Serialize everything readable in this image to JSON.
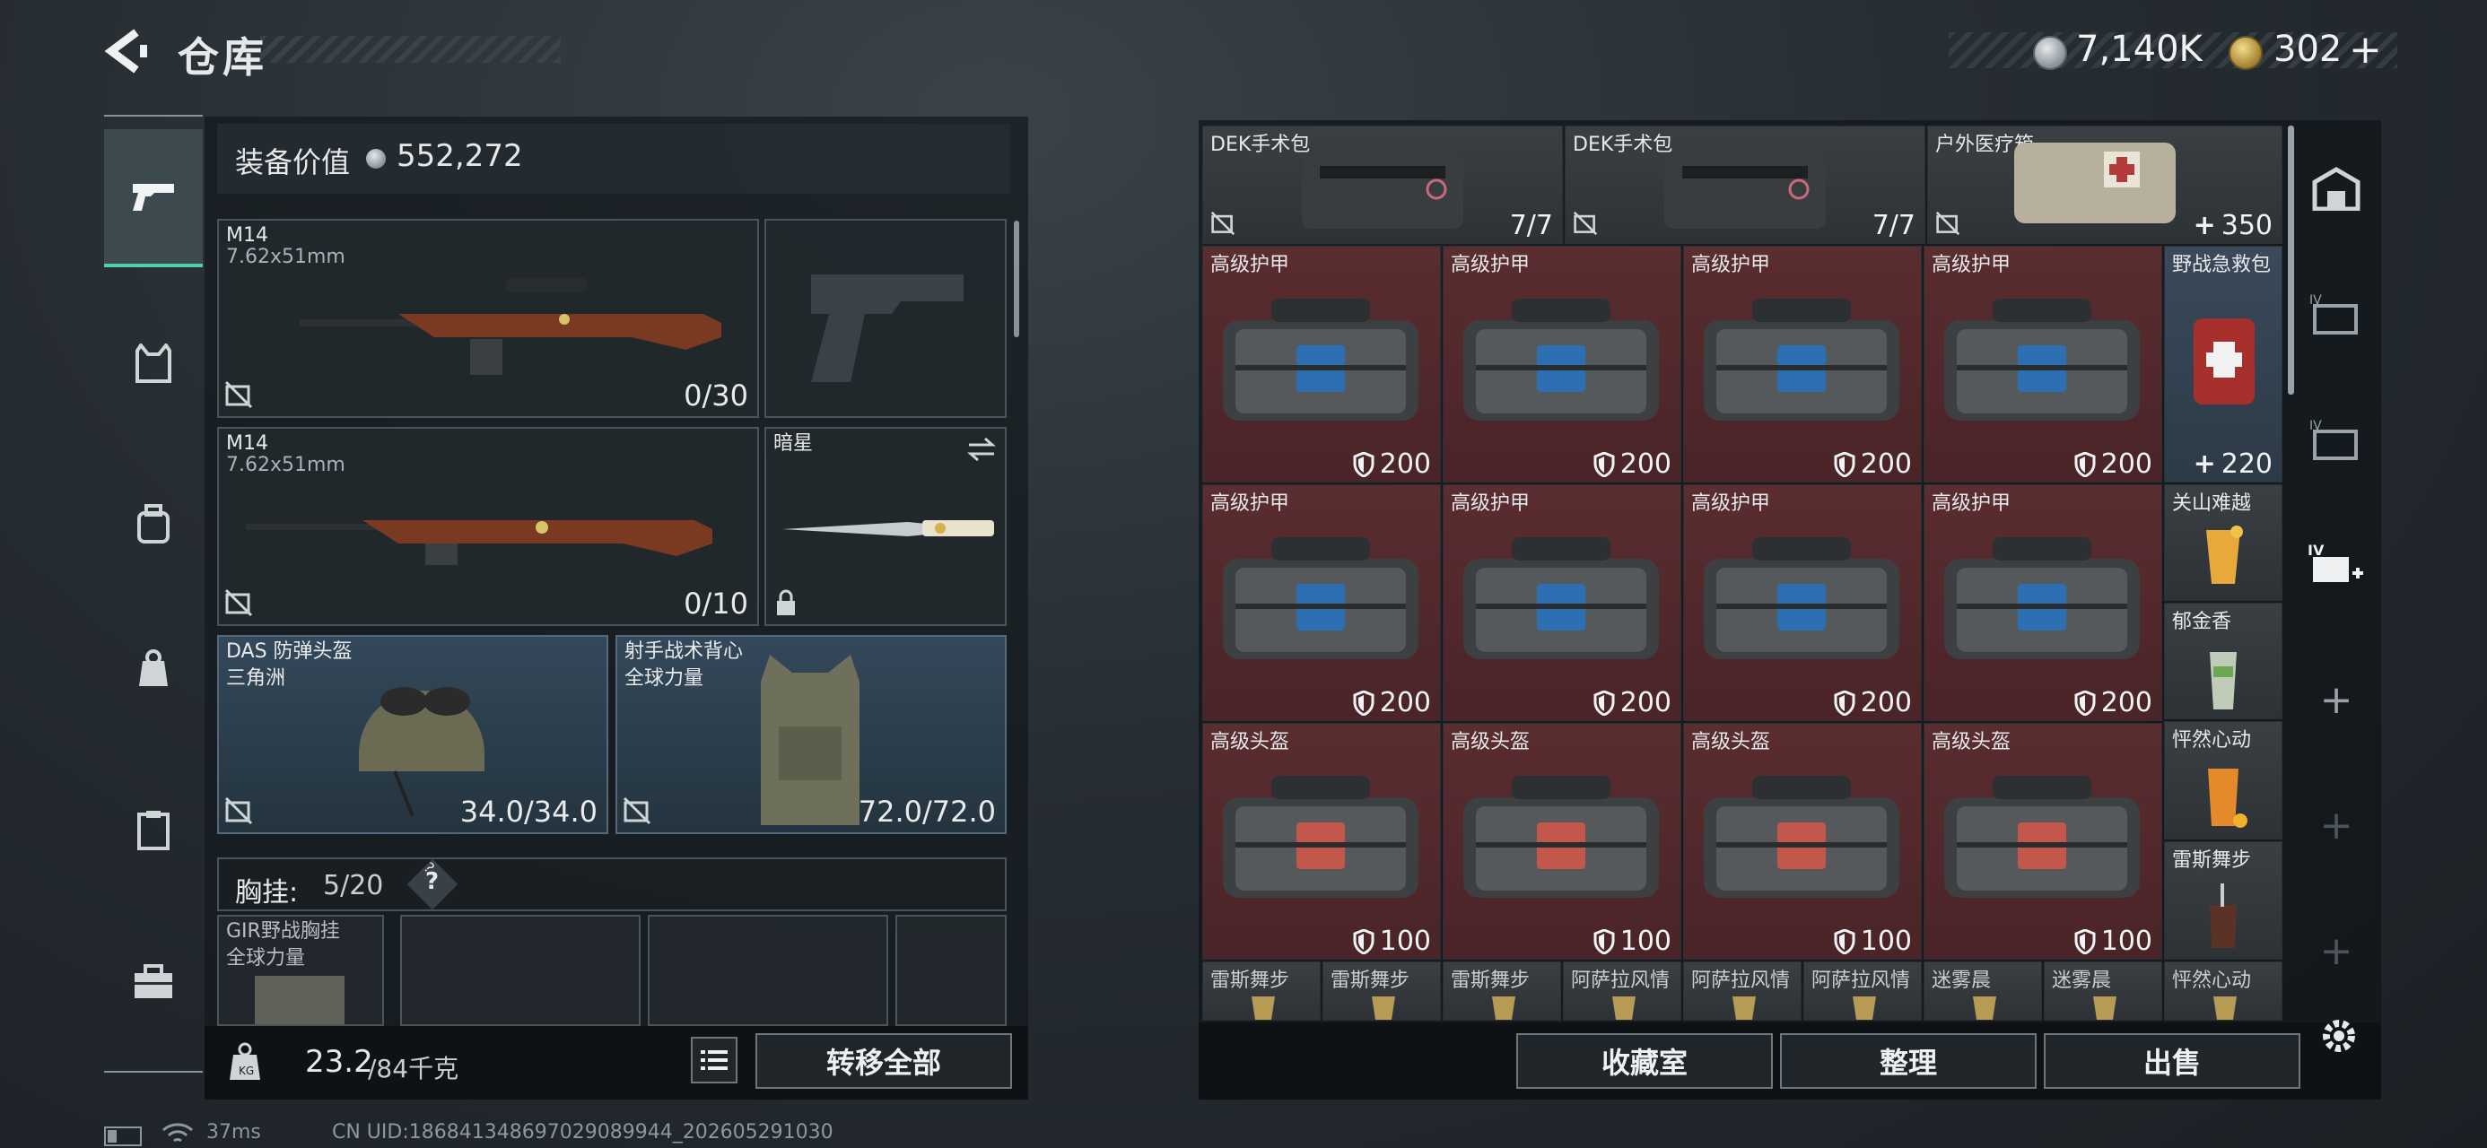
{
  "header": {
    "title": "仓库"
  },
  "currency": [
    {
      "icon": "silver-coin-icon",
      "value": "7,140K"
    },
    {
      "icon": "gold-coin-icon",
      "value": "302",
      "action": "+"
    }
  ],
  "equipment": {
    "value_label": "装备价值",
    "value": "552,272",
    "slots": [
      {
        "name": "M14",
        "sub": "7.62x51mm",
        "count": "0/30"
      },
      {
        "name": "M14",
        "sub": "7.62x51mm",
        "count": "0/10"
      },
      {
        "name": "暗星",
        "sub": "",
        "count": ""
      },
      {
        "name": "DAS 防弹头盔",
        "sub": "三角洲",
        "count": "34.0/34.0"
      },
      {
        "name": "射手战术背心",
        "sub": "全球力量",
        "count": "72.0/72.0"
      }
    ],
    "rig_label": "胸挂:",
    "rig_count": "5/20",
    "rig_help": "?",
    "rig_slots": [
      {
        "name": "GIR野战胸挂",
        "sub": "全球力量"
      }
    ]
  },
  "bottom": {
    "weight": "23.2",
    "weight_max": "/84千克",
    "transfer_all": "转移全部"
  },
  "stash": {
    "top_row": [
      {
        "name": "DEK手术包",
        "value": "7/7"
      },
      {
        "name": "DEK手术包",
        "value": "7/7"
      },
      {
        "name": "户外医疗箱",
        "value": "350"
      }
    ],
    "grid": [
      [
        {
          "name": "高级护甲",
          "value": "200"
        },
        {
          "name": "高级护甲",
          "value": "200"
        },
        {
          "name": "高级护甲",
          "value": "200"
        },
        {
          "name": "高级护甲",
          "value": "200"
        }
      ],
      [
        {
          "name": "高级护甲",
          "value": "200"
        },
        {
          "name": "高级护甲",
          "value": "200"
        },
        {
          "name": "高级护甲",
          "value": "200"
        },
        {
          "name": "高级护甲",
          "value": "200"
        }
      ],
      [
        {
          "name": "高级头盔",
          "value": "100"
        },
        {
          "name": "高级头盔",
          "value": "100"
        },
        {
          "name": "高级头盔",
          "value": "100"
        },
        {
          "name": "高级头盔",
          "value": "100"
        }
      ]
    ],
    "side_column": [
      {
        "name": "野战急救包",
        "value": "220"
      },
      {
        "name": "关山难越"
      },
      {
        "name": "郁金香"
      },
      {
        "name": "怦然心动"
      },
      {
        "name": "雷斯舞步"
      }
    ],
    "bottom_row": [
      "雷斯舞步",
      "雷斯舞步",
      "雷斯舞步",
      "阿萨拉风情",
      "阿萨拉风情",
      "阿萨拉风情",
      "迷雾晨",
      "迷雾晨",
      "怦然心动"
    ],
    "buttons": {
      "collection": "收藏室",
      "sort": "整理",
      "sell": "出售"
    }
  },
  "status": {
    "ping": "37ms",
    "uid": "CN UID:186841348697029089944_202605291030"
  },
  "colors": {
    "accent": "#4fd1a5",
    "armor_bg": "#5a2d30",
    "slot_blue": "#33485a"
  }
}
